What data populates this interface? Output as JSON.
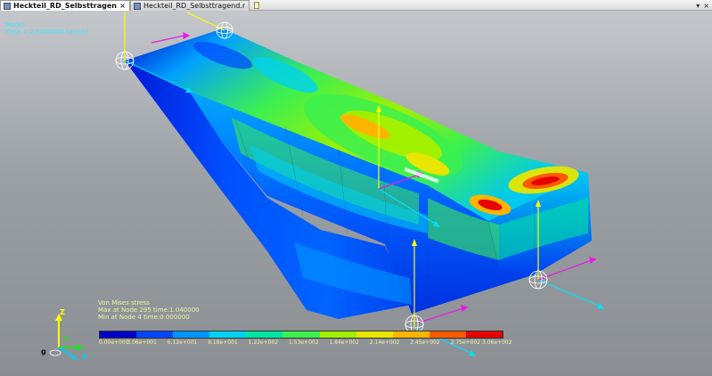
{
  "tabs": [
    {
      "label": "Heckteil_RD_Selbsttragend.r...",
      "close": "×",
      "active": true
    },
    {
      "label": "Heckteil_RD_Selbsttragend.rdyn",
      "close": "",
      "active": false
    }
  ],
  "window_controls": {
    "dropdown": "▾",
    "close": "×"
  },
  "hud": {
    "model_label": "Model",
    "time_label": "Time = 2.0000000 Second"
  },
  "legend": {
    "title": "Von Mises stress",
    "max_text": "Max at Node 295 time:1.040000",
    "min_text": "Min at Node 4 time:0.000000",
    "tick_labels": [
      "0.00e+000",
      "3.06e+001",
      "6.12e+001",
      "9.18e+001",
      "1.22e+002",
      "1.53e+002",
      "1.84e+002",
      "2.14e+002",
      "2.45e+002",
      "2.75e+002",
      "3.06e+002"
    ],
    "colors": [
      "#0000c8",
      "#0046ff",
      "#0096ff",
      "#00d2f0",
      "#00e6a0",
      "#3cf050",
      "#a0f000",
      "#e6e600",
      "#ffb400",
      "#ff5a00",
      "#e60000"
    ]
  },
  "triad": {
    "z": "Z",
    "y": "Y",
    "x": "X",
    "g": "g"
  },
  "colors": {
    "background_top": "#c4c7cb",
    "background_bottom": "#8b8f93",
    "hud_text": "#3ee6ff",
    "legend_text": "#f1f1a6",
    "force_arrow": "#e81ae8",
    "local_axis_y": "#ffff00",
    "local_axis_x": "#00e0ff"
  }
}
